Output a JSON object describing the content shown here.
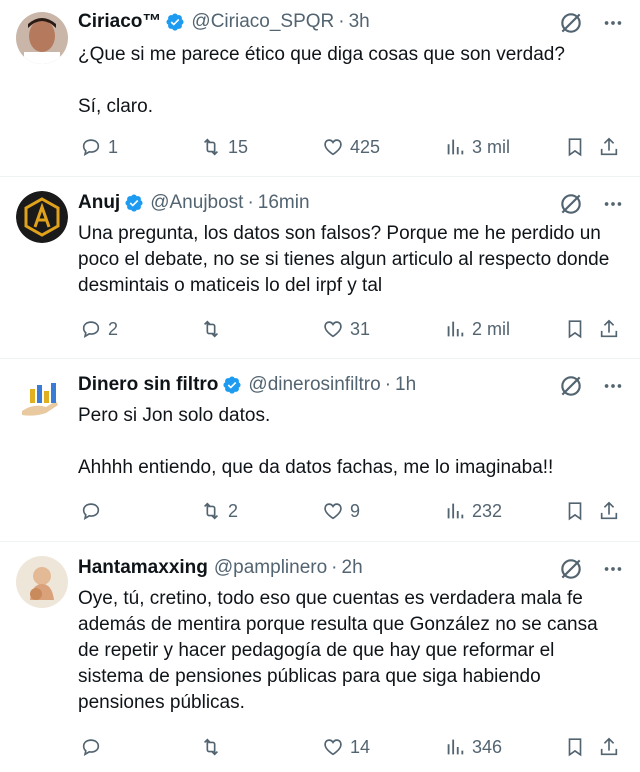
{
  "tweets": [
    {
      "name": "Ciriaco™",
      "handle": "@Ciriaco_SPQR",
      "time": "3h",
      "paragraphs": [
        "¿Que si me parece ético que diga cosas que son verdad?",
        "Sí, claro."
      ],
      "replies": "1",
      "retweets": "15",
      "likes": "425",
      "views": "3 mil"
    },
    {
      "name": "Anuj",
      "handle": "@Anujbost",
      "time": "16min",
      "paragraphs": [
        "Una pregunta, los datos son falsos? Porque me he perdido un poco el debate, no se si tienes algun articulo al respecto donde desmintais o maticeis lo del irpf y tal"
      ],
      "replies": "2",
      "retweets": "",
      "likes": "31",
      "views": "2 mil"
    },
    {
      "name": "Dinero sin filtro",
      "handle": "@dinerosinfiltro",
      "time": "1h",
      "paragraphs": [
        "Pero si Jon solo datos.",
        "Ahhhh entiendo, que da datos fachas, me lo imaginaba!!"
      ],
      "replies": "",
      "retweets": "2",
      "likes": "9",
      "views": "232"
    },
    {
      "name": "Hantamaxxing",
      "handle": "@pamplinero",
      "time": "2h",
      "paragraphs": [
        "Oye, tú, cretino, todo eso que cuentas es verdadera mala fe además de mentira porque resulta que González no se cansa de repetir y hacer pedagogía de que hay que reformar el sistema de pensiones públicas para que siga habiendo pensiones públicas."
      ],
      "replies": "",
      "retweets": "",
      "likes": "14",
      "views": "346"
    }
  ],
  "colors": {
    "text": "#0f1419",
    "muted": "#536471",
    "verified": "#1d9bf0",
    "border": "#eff3f4"
  }
}
